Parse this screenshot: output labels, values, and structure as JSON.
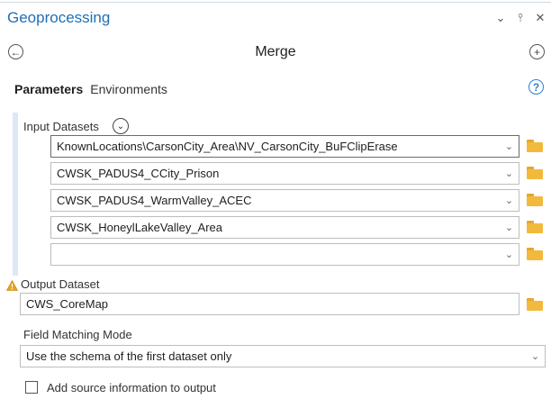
{
  "pane": {
    "title": "Geoprocessing",
    "buttons": {
      "options": "⌄",
      "pin": "⫯",
      "close": "✕"
    }
  },
  "tool": {
    "title": "Merge"
  },
  "tabs": [
    {
      "label": "Parameters",
      "active": true
    },
    {
      "label": "Environments",
      "active": false
    }
  ],
  "params": {
    "input_datasets": {
      "label": "Input Datasets",
      "rows": [
        "KnownLocations\\CarsonCity_Area\\NV_CarsonCity_BuFClipErase",
        "CWSK_PADUS4_CCity_Prison",
        "CWSK_PADUS4_WarmValley_ACEC",
        "CWSK_HoneylLakeValley_Area",
        ""
      ]
    },
    "output_dataset": {
      "label": "Output Dataset",
      "value": "CWS_CoreMap"
    },
    "field_matching_mode": {
      "label": "Field Matching Mode",
      "value": "Use the schema of the first dataset only"
    },
    "add_source_info": {
      "label": "Add source information to output",
      "checked": false
    }
  },
  "colors": {
    "accent": "#1f6fb6",
    "folder": "#f3b93d",
    "warning": "#e8a317"
  }
}
